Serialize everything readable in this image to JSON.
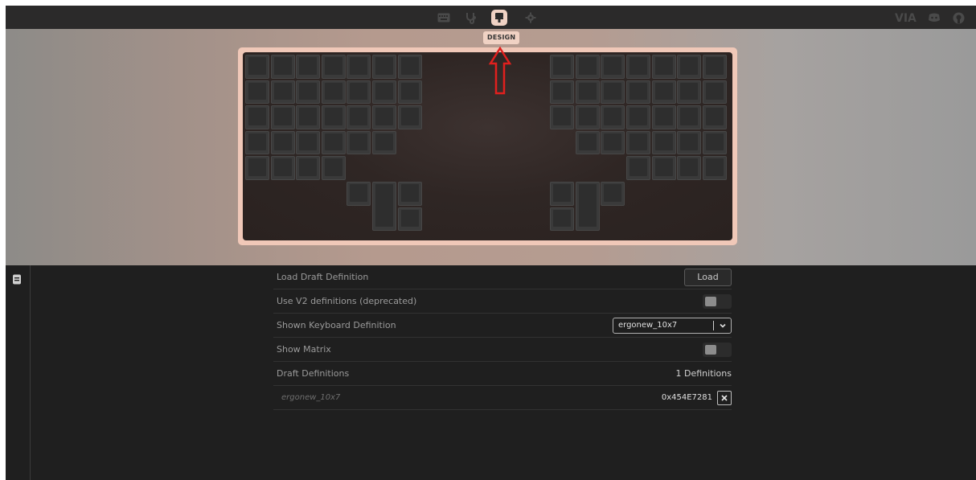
{
  "topbar": {
    "nav": [
      {
        "name": "keyboard-icon",
        "active": false
      },
      {
        "name": "test-icon",
        "active": false
      },
      {
        "name": "design-icon",
        "active": true
      },
      {
        "name": "settings-icon",
        "active": false
      }
    ],
    "brand_label": "VIA",
    "right_icons": [
      "discord-icon",
      "github-icon"
    ],
    "tooltip": "DESIGN"
  },
  "colors": {
    "accent": "#f0d2c4",
    "arrow": "#e0201e"
  },
  "design": {
    "rows": [
      {
        "label": "Load Draft Definition",
        "button": "Load"
      },
      {
        "label": "Use V2 definitions (deprecated)",
        "toggle": false
      },
      {
        "label": "Shown Keyboard Definition",
        "select_value": "ergonew_10x7"
      },
      {
        "label": "Show Matrix",
        "toggle": false
      },
      {
        "label": "Draft Definitions",
        "value": "1 Definitions"
      },
      {
        "label": "ergonew_10x7",
        "value": "0x454E7281"
      }
    ]
  }
}
